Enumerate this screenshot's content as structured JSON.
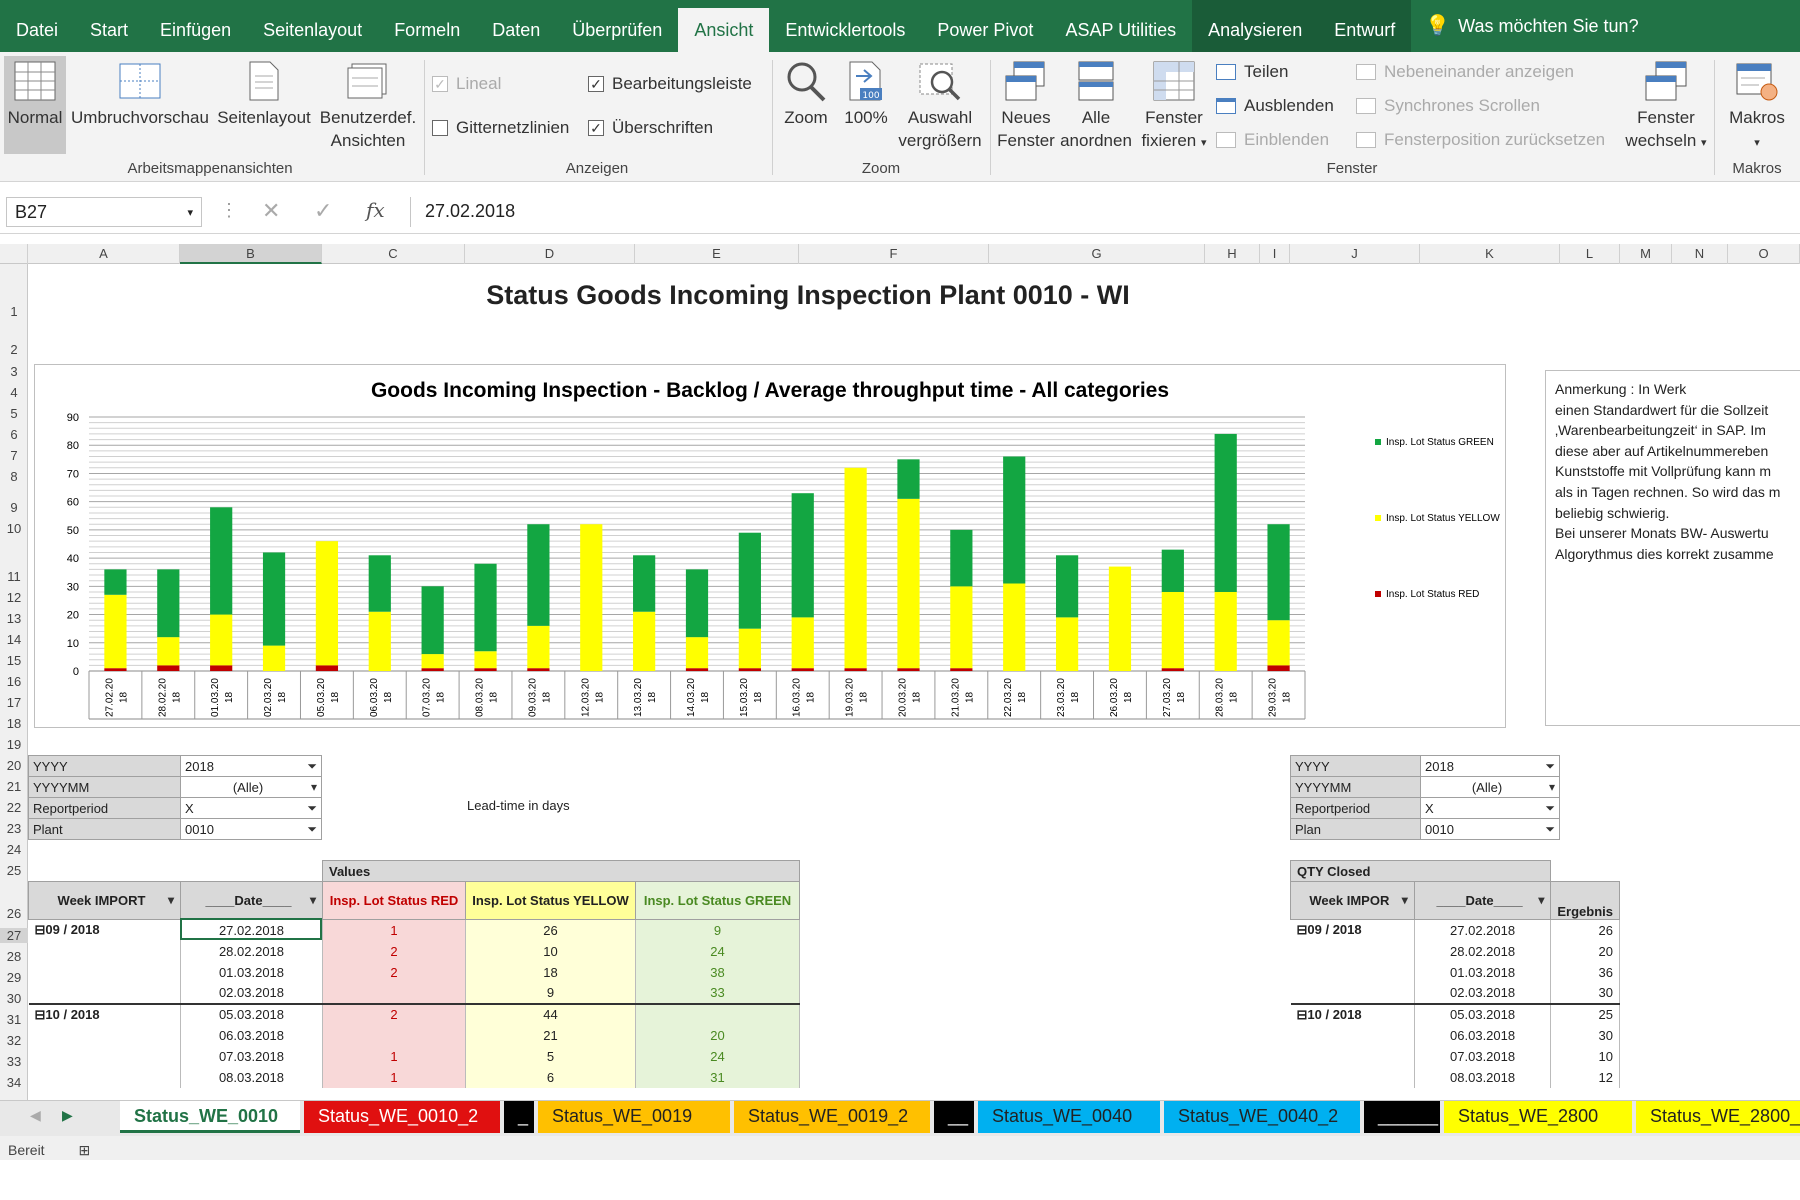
{
  "ribbon_tabs": [
    "Datei",
    "Start",
    "Einfügen",
    "Seitenlayout",
    "Formeln",
    "Daten",
    "Überprüfen",
    "Ansicht",
    "Entwicklertools",
    "Power Pivot",
    "ASAP Utilities",
    "Analysieren",
    "Entwurf"
  ],
  "tell_me": "Was möchten Sie tun?",
  "ribbon": {
    "views": [
      "Normal",
      "Umbruchvorschau",
      "Seitenlayout",
      "Benutzerdef.",
      "Ansichten"
    ],
    "group_views": "Arbeitsmappenansichten",
    "show": {
      "lineal": "Lineal",
      "bearb": "Bearbeitungsleiste",
      "gitter": "Gitternetzlinien",
      "ueber": "Überschriften"
    },
    "group_show": "Anzeigen",
    "zoom": [
      "Zoom",
      "100%",
      "Auswahl",
      "vergrößern"
    ],
    "zoom_badge": "100",
    "group_zoom": "Zoom",
    "window": [
      "Neues",
      "Fenster",
      "Alle",
      "anordnen",
      "Fenster",
      "fixieren"
    ],
    "teilen": "Teilen",
    "ausblenden": "Ausblenden",
    "einblenden": "Einblenden",
    "neben": "Nebeneinander anzeigen",
    "sync": "Synchrones Scrollen",
    "pos": "Fensterposition zurücksetzen",
    "wechseln": [
      "Fenster",
      "wechseln"
    ],
    "group_window": "Fenster",
    "makros": "Makros",
    "group_makros": "Makros"
  },
  "namebox": "B27",
  "formula": "27.02.2018",
  "columns": [
    "A",
    "B",
    "C",
    "D",
    "E",
    "F",
    "G",
    "H",
    "I",
    "J",
    "K",
    "L",
    "M",
    "N",
    "O"
  ],
  "rows": [
    "1",
    "2",
    "3",
    "4",
    "5",
    "6",
    "7",
    "8",
    "9",
    "10",
    "11",
    "12",
    "13",
    "14",
    "15",
    "16",
    "17",
    "18",
    "19",
    "20",
    "21",
    "22",
    "23",
    "24",
    "25",
    "26",
    "27",
    "28",
    "29",
    "30",
    "31",
    "32",
    "33",
    "34"
  ],
  "sheet_title": "Status Goods Incoming Inspection Plant 0010 - WI",
  "chart_data": {
    "type": "bar",
    "title": "Goods Incoming Inspection - Backlog / Average throughput time - All categories",
    "categories": [
      "27.02.20\n18",
      "28.02.20\n18",
      "01.03.20\n18",
      "02.03.20\n18",
      "05.03.20\n18",
      "06.03.20\n18",
      "07.03.20\n18",
      "08.03.20\n18",
      "09.03.20\n18",
      "12.03.20\n18",
      "13.03.20\n18",
      "14.03.20\n18",
      "15.03.20\n18",
      "16.03.20\n18",
      "19.03.20\n18",
      "20.03.20\n18",
      "21.03.20\n18",
      "22.03.20\n18",
      "23.03.20\n18",
      "26.03.20\n18",
      "27.03.20\n18",
      "28.03.20\n18",
      "29.03.20\n18"
    ],
    "stacked": true,
    "series": [
      {
        "name": "Insp. Lot Status RED",
        "color": "#c00000",
        "values": [
          1,
          2,
          2,
          0,
          2,
          0,
          1,
          1,
          1,
          0,
          0,
          1,
          1,
          1,
          1,
          1,
          1,
          0,
          0,
          0,
          1,
          0,
          2
        ]
      },
      {
        "name": "Insp. Lot Status YELLOW",
        "color": "#ffff00",
        "values": [
          26,
          10,
          18,
          9,
          44,
          21,
          5,
          6,
          15,
          52,
          21,
          11,
          14,
          18,
          71,
          60,
          29,
          31,
          19,
          37,
          27,
          28,
          16
        ]
      },
      {
        "name": "Insp. Lot Status GREEN",
        "color": "#13a642",
        "values": [
          9,
          24,
          38,
          33,
          0,
          20,
          24,
          31,
          36,
          0,
          20,
          24,
          34,
          44,
          0,
          14,
          20,
          45,
          22,
          0,
          15,
          56,
          34
        ]
      }
    ],
    "ylim": [
      0,
      90
    ],
    "yticks": [
      "0",
      "10",
      "20",
      "30",
      "40",
      "50",
      "60",
      "70",
      "80",
      "90"
    ],
    "grid": true,
    "legend": "right"
  },
  "note": [
    "Anmerkung                      : In Werk",
    "einen Standardwert für die Sollzeit",
    "‚Warenbearbeitungzeit‘ in SAP. Im",
    "diese aber auf Artikelnummereben",
    "Kunststoffe mit Vollprüfung kann m",
    "als in Tagen rechnen. So wird das m",
    "beliebig schwierig.",
    "Bei unserer Monats BW- Auswertu",
    "Algorythmus dies korrekt zusamme"
  ],
  "filters_left": [
    [
      "YYYY",
      "2018"
    ],
    [
      "YYYYMM",
      "(Alle)"
    ],
    [
      "Reportperiod",
      "X"
    ],
    [
      "Plant",
      "0010"
    ]
  ],
  "filters_right": [
    [
      "YYYY",
      "2018"
    ],
    [
      "YYYYMM",
      "(Alle)"
    ],
    [
      "Reportperiod",
      "X"
    ],
    [
      "Plan",
      "0010"
    ]
  ],
  "lead_time_label": "Lead-time in days",
  "pivot_left": {
    "values_label": "Values",
    "headers": [
      "Week IMPORT",
      "____Date____",
      "Insp. Lot Status RED",
      "Insp. Lot Status YELLOW",
      "Insp. Lot Status  GREEN"
    ],
    "rows": [
      [
        "⊟09 / 2018",
        "27.02.2018",
        "1",
        "26",
        "9"
      ],
      [
        "",
        "28.02.2018",
        "2",
        "10",
        "24"
      ],
      [
        "",
        "01.03.2018",
        "2",
        "18",
        "38"
      ],
      [
        "",
        "02.03.2018",
        "",
        "9",
        "33"
      ],
      [
        "⊟10 / 2018",
        "05.03.2018",
        "2",
        "44",
        ""
      ],
      [
        "",
        "06.03.2018",
        "",
        "21",
        "20"
      ],
      [
        "",
        "07.03.2018",
        "1",
        "5",
        "24"
      ],
      [
        "",
        "08.03.2018",
        "1",
        "6",
        "31"
      ]
    ]
  },
  "pivot_right": {
    "values_label": "QTY Closed",
    "headers": [
      "Week IMPOR",
      "____Date____",
      "Ergebnis"
    ],
    "rows": [
      [
        "⊟09 / 2018",
        "27.02.2018",
        "26"
      ],
      [
        "",
        "28.02.2018",
        "20"
      ],
      [
        "",
        "01.03.2018",
        "36"
      ],
      [
        "",
        "02.03.2018",
        "30"
      ],
      [
        "⊟10 / 2018",
        "05.03.2018",
        "25"
      ],
      [
        "",
        "06.03.2018",
        "30"
      ],
      [
        "",
        "07.03.2018",
        "10"
      ],
      [
        "",
        "08.03.2018",
        "12"
      ]
    ]
  },
  "sheet_tabs": [
    {
      "label": "Status_WE_0010",
      "color": "#ffffff",
      "text": "#217346"
    },
    {
      "label": "Status_WE_0010_2",
      "color": "#e01010",
      "text": "#ffffff"
    },
    {
      "label": "_",
      "color": "#000000",
      "text": "#ffffff"
    },
    {
      "label": "Status_WE_0019",
      "color": "#ffc000",
      "text": "#222222"
    },
    {
      "label": "Status_WE_0019_2",
      "color": "#ffc000",
      "text": "#222222"
    },
    {
      "label": "__",
      "color": "#000000",
      "text": "#ffffff"
    },
    {
      "label": "Status_WE_0040",
      "color": "#00b0f0",
      "text": "#222222"
    },
    {
      "label": "Status_WE_0040_2",
      "color": "#00b0f0",
      "text": "#222222"
    },
    {
      "label": "______",
      "color": "#000000",
      "text": "#ffffff"
    },
    {
      "label": "Status_WE_2800",
      "color": "#ffff00",
      "text": "#222222"
    },
    {
      "label": "Status_WE_2800_...",
      "color": "#ffff00",
      "text": "#222222"
    }
  ],
  "status": "Bereit"
}
